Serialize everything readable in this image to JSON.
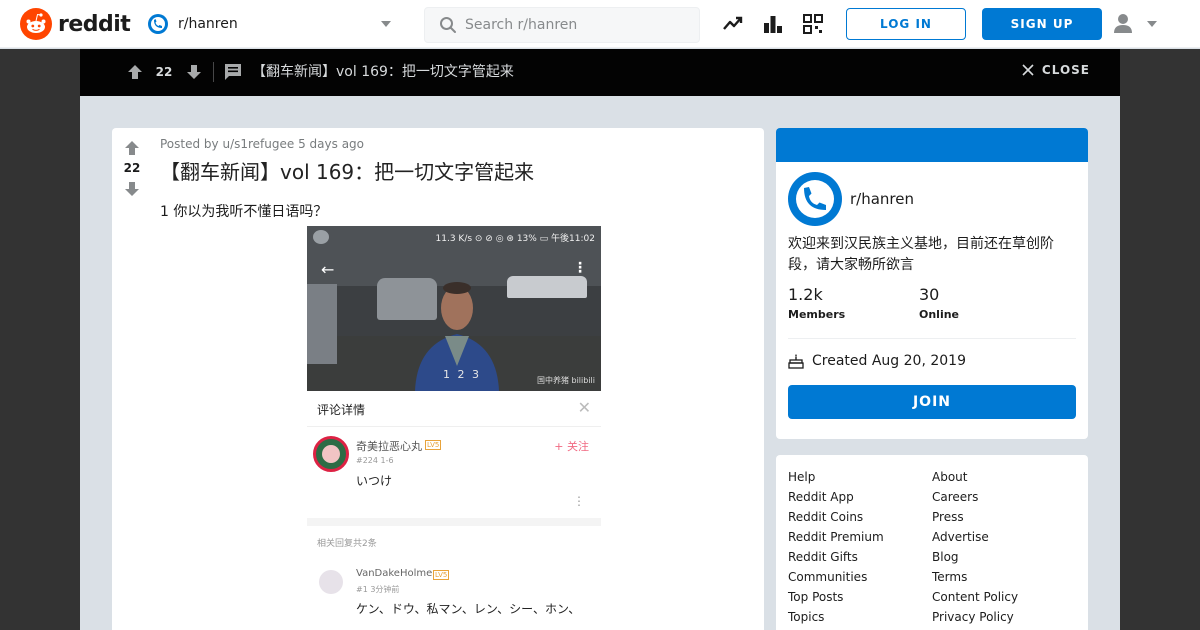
{
  "header": {
    "brand": "reddit",
    "subreddit": "r/hanren",
    "search_placeholder": "Search r/hanren",
    "login_label": "LOG IN",
    "signup_label": "SIGN UP"
  },
  "post_topbar": {
    "score": "22",
    "title": "【翻车新闻】vol 169：把一切文字管起来",
    "close_label": "CLOSE"
  },
  "post": {
    "score": "22",
    "meta_prefix": "Posted by",
    "author": "u/s1refugee",
    "age": "5 days ago",
    "title": "【翻车新闻】vol 169：把一切文字管起来",
    "body": "1 你以为我听不懂日语吗？",
    "image": {
      "status_right": "11.3 K/s ⊙ ⊘ ◎ ⊛ 13% ▭ 午後11:02",
      "timecode": "1 2 3",
      "watermark": "国中养猪 bilibili",
      "comment_header": "评论详情",
      "comment1": {
        "name": "奇美拉恶心丸",
        "level": "LV5",
        "follow": "+ 关注",
        "sub": "#224  1-6",
        "body": "いつけ"
      },
      "reply_count": "相关回复共2条",
      "comment2": {
        "name": "VanDakeHolme",
        "level": "LV5",
        "sub": "#1  3分钟前",
        "body": "ケン、ドウ、私マン、レン、シー、ホン、"
      }
    }
  },
  "community": {
    "name": "r/hanren",
    "description": "欢迎来到汉民族主义基地，目前还在草创阶段，请大家畅所欲言",
    "members_value": "1.2k",
    "members_label": "Members",
    "online_value": "30",
    "online_label": "Online",
    "created": "Created Aug 20, 2019",
    "join_label": "JOIN"
  },
  "footer_links": {
    "col1": [
      "Help",
      "Reddit App",
      "Reddit Coins",
      "Reddit Premium",
      "Reddit Gifts",
      "Communities",
      "Top Posts",
      "Topics"
    ],
    "col2": [
      "About",
      "Careers",
      "Press",
      "Advertise",
      "Blog",
      "Terms",
      "Content Policy",
      "Privacy Policy"
    ]
  },
  "colors": {
    "brand_orange": "#ff4500",
    "accent_blue": "#0079d3",
    "overlay_black": "#030303"
  },
  "icons": [
    "reddit-logo-icon",
    "subreddit-icon",
    "search-icon",
    "trending-icon",
    "leaderboard-icon",
    "coins-icon",
    "user-icon",
    "upvote-icon",
    "downvote-icon",
    "comment-icon",
    "close-icon",
    "cake-icon"
  ]
}
